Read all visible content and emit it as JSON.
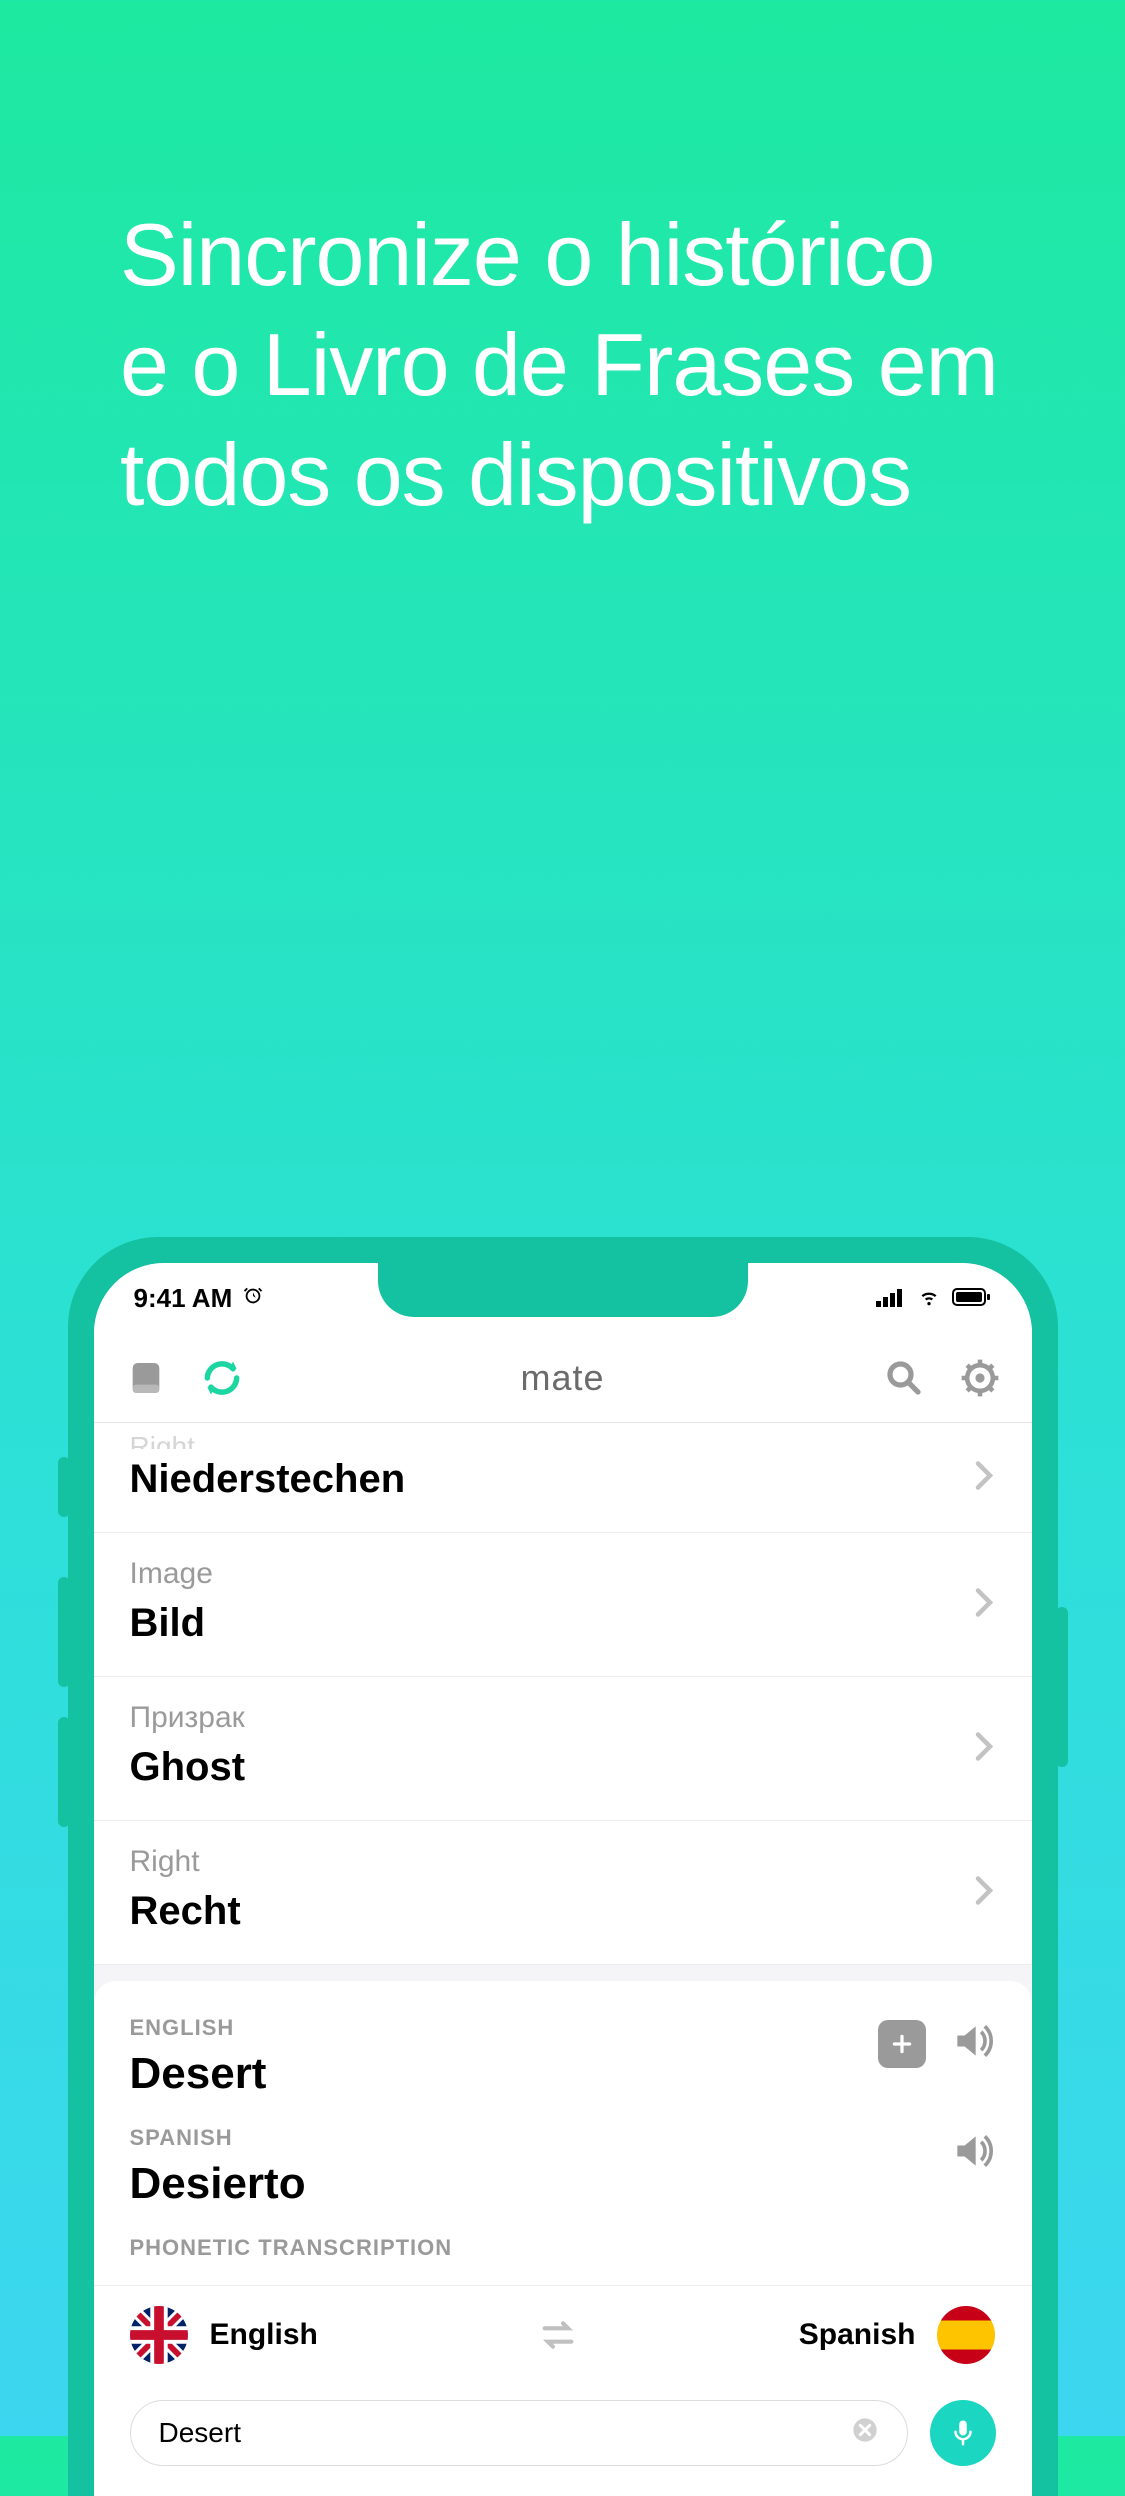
{
  "marketing": {
    "headline": "Sincronize o histórico e o Livro de Frases em todos os dispositivos"
  },
  "status_bar": {
    "time": "9:41 AM"
  },
  "header": {
    "title": "mate"
  },
  "history": [
    {
      "source": "Right",
      "translation": "Niederstechen"
    },
    {
      "source": "Image",
      "translation": "Bild"
    },
    {
      "source": "Призрак",
      "translation": "Ghost"
    },
    {
      "source": "Right",
      "translation": "Recht"
    }
  ],
  "translation_card": {
    "source_lang_label": "ENGLISH",
    "source_text": "Desert",
    "target_lang_label": "SPANISH",
    "target_text": "Desierto",
    "phonetic_label": "PHONETIC TRANSCRIPTION"
  },
  "lang_bar": {
    "from": "English",
    "to": "Spanish"
  },
  "input": {
    "value": "Desert"
  }
}
